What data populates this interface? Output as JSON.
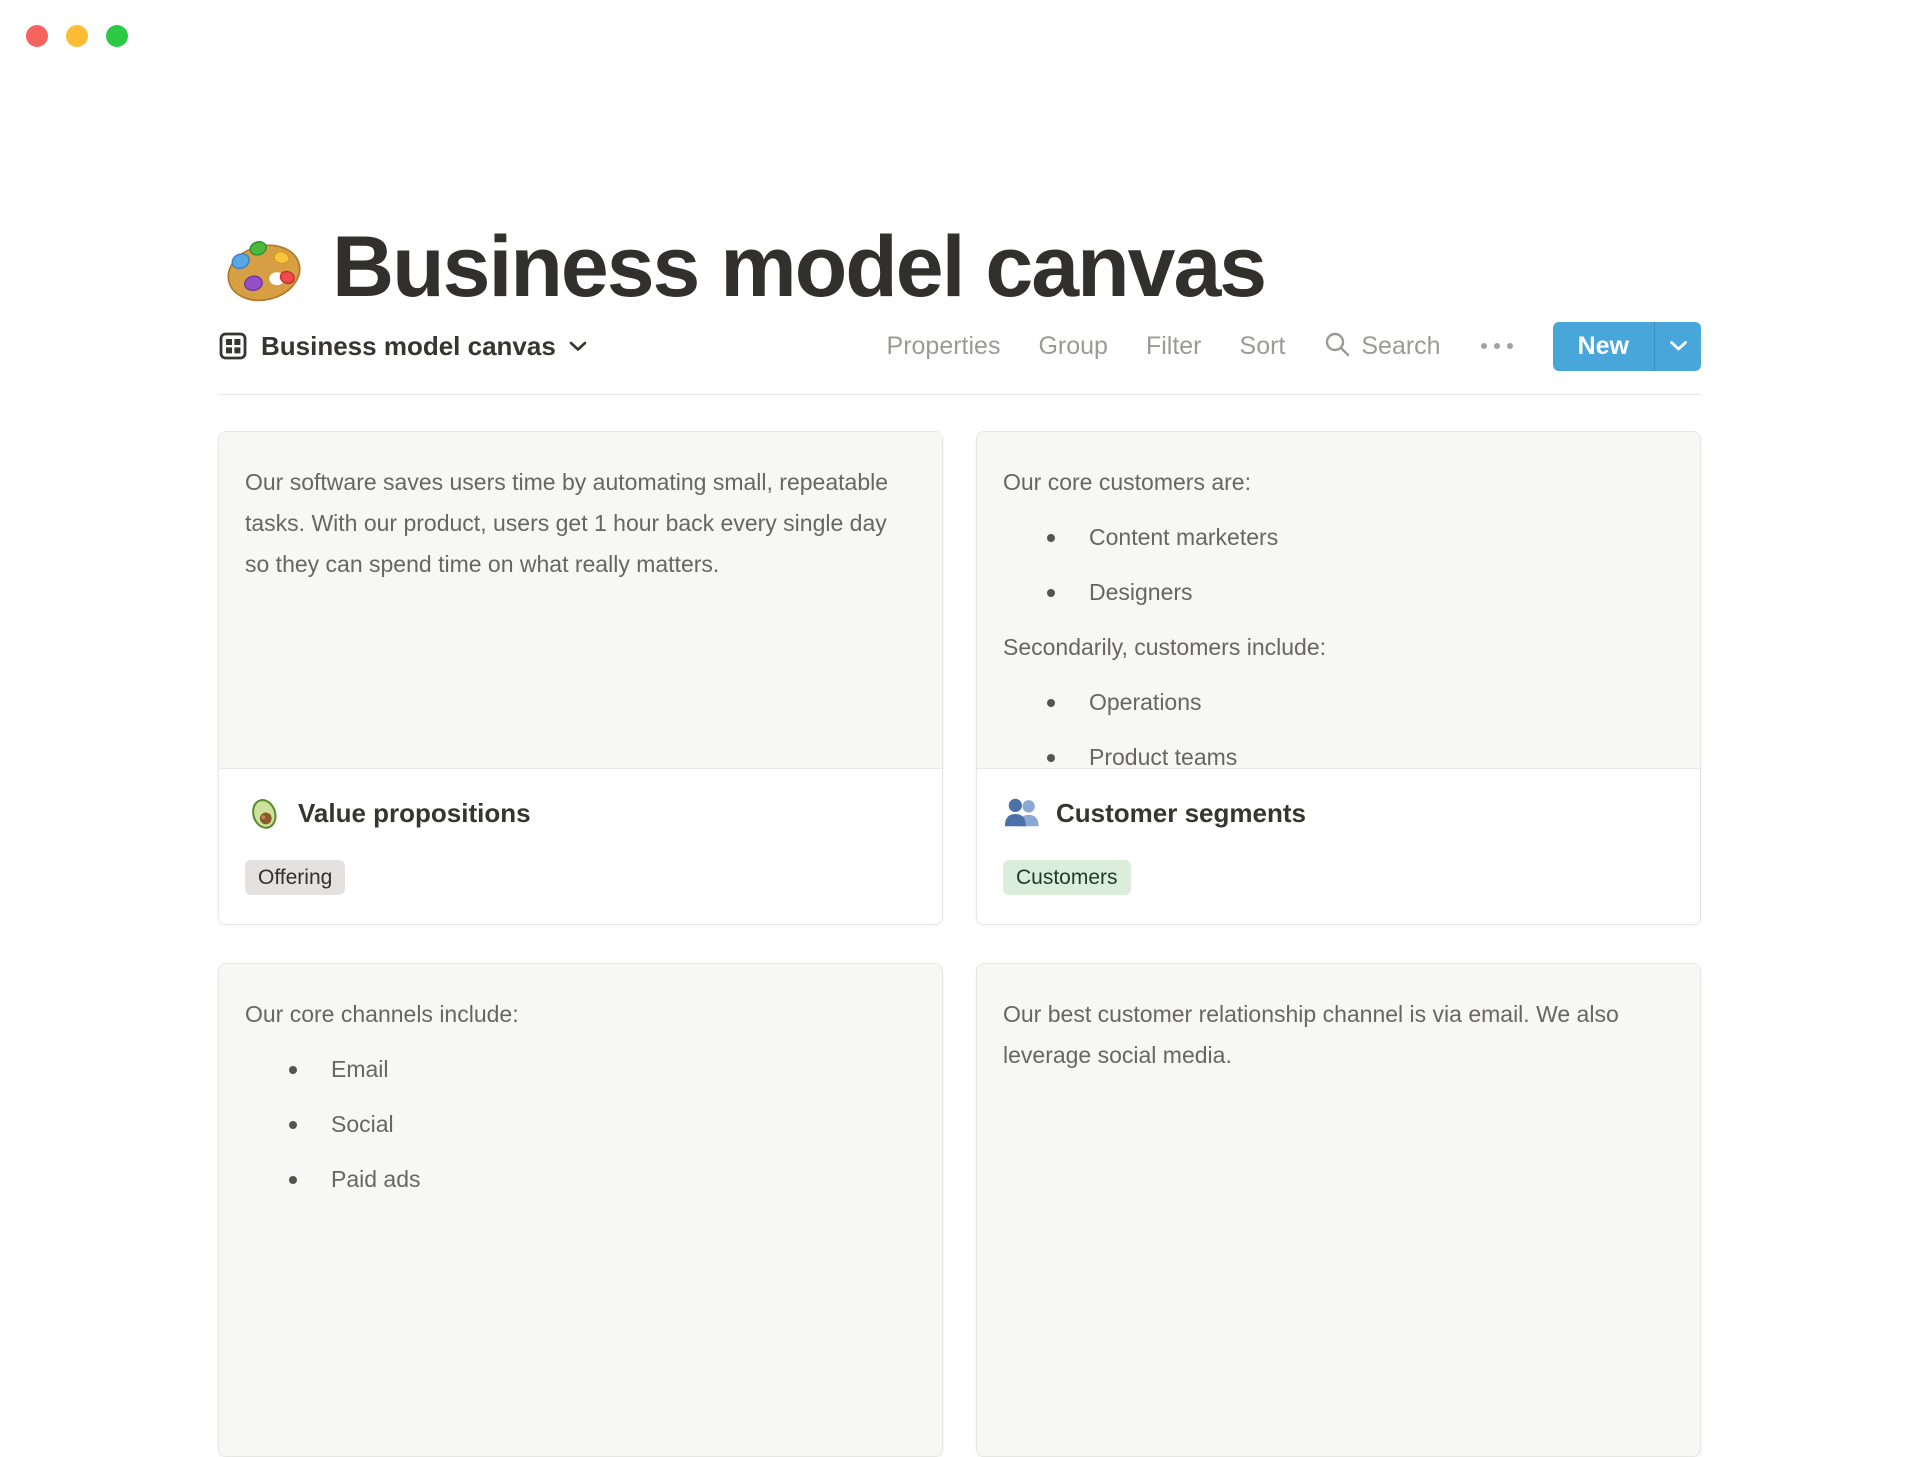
{
  "window": {
    "controls": [
      "close",
      "minimize",
      "zoom"
    ]
  },
  "page": {
    "icon": "palette-emoji",
    "title": "Business model canvas"
  },
  "view_bar": {
    "view_icon": "gallery-view-icon",
    "view_name": "Business model canvas",
    "view_dropdown_icon": "chevron-down-icon",
    "toolbar": {
      "properties": "Properties",
      "group": "Group",
      "filter": "Filter",
      "sort": "Sort",
      "search": "Search",
      "search_icon": "search-icon",
      "more_icon": "ellipsis-icon",
      "new": "New",
      "new_dropdown_icon": "chevron-down-icon"
    }
  },
  "colors": {
    "accent_blue": "#49a6da",
    "preview_bg": "#f7f7f5",
    "card_border": "#e6e6e4",
    "tag_gray_bg": "#e3e2e0",
    "tag_green_bg": "#dbeddb",
    "toolbar_gray": "#9b9a97",
    "traffic_red": "#f6625d",
    "traffic_yellow": "#fdbc33",
    "traffic_green": "#2ec944"
  },
  "cards": [
    {
      "icon": "avocado-emoji",
      "title": "Value propositions",
      "tags": [
        {
          "label": "Offering",
          "color": "gray"
        }
      ],
      "preview_blocks": [
        {
          "type": "p",
          "text": "Our software saves users time by automating small, repeatable tasks. With our product, users get 1 hour back every single day so they can spend time on what really matters."
        }
      ]
    },
    {
      "icon": "busts-in-silhouette-emoji",
      "title": "Customer segments",
      "tags": [
        {
          "label": "Customers",
          "color": "green"
        }
      ],
      "preview_blocks": [
        {
          "type": "p",
          "text": "Our core customers are:"
        },
        {
          "type": "li",
          "text": "Content marketers"
        },
        {
          "type": "li",
          "text": "Designers"
        },
        {
          "type": "p",
          "text": "Secondarily, customers include:"
        },
        {
          "type": "li",
          "text": "Operations"
        },
        {
          "type": "li",
          "text": "Product teams"
        }
      ]
    },
    {
      "preview_blocks": [
        {
          "type": "p",
          "text": "Our core channels include:"
        },
        {
          "type": "li",
          "text": "Email"
        },
        {
          "type": "li",
          "text": "Social"
        },
        {
          "type": "li",
          "text": "Paid ads"
        }
      ]
    },
    {
      "preview_blocks": [
        {
          "type": "p",
          "text": "Our best customer relationship channel is via email. We also leverage social media."
        }
      ]
    }
  ]
}
